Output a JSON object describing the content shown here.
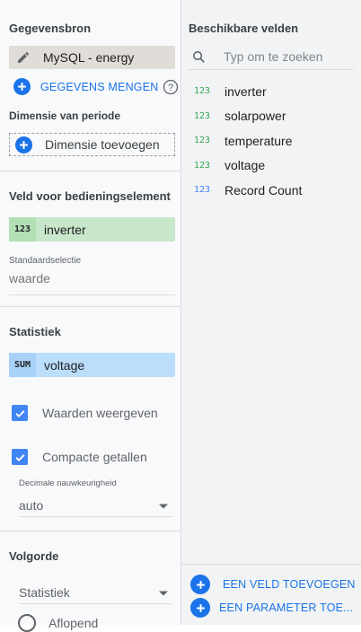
{
  "data_source": {
    "title": "Gegevensbron",
    "source_name": "MySQL - energy",
    "blend_label": "GEGEVENS MENGEN"
  },
  "period": {
    "title": "Dimensie van periode",
    "add_label": "Dimensie toevoegen"
  },
  "control_field": {
    "title": "Veld voor bedieningselement",
    "type_badge": "123",
    "field_name": "inverter",
    "default_label": "Standaardselectie",
    "default_placeholder": "waarde"
  },
  "statistic": {
    "title": "Statistiek",
    "agg_badge": "SUM",
    "field_name": "voltage",
    "show_values_label": "Waarden weergeven",
    "compact_numbers_label": "Compacte getallen",
    "decimal_label": "Decimale nauwkeurigheid",
    "decimal_value": "auto"
  },
  "order": {
    "title": "Volgorde",
    "select_value": "Statistiek",
    "radio_label": "Aflopend"
  },
  "available_fields": {
    "title": "Beschikbare velden",
    "search_placeholder": "Typ om te zoeken",
    "fields": [
      {
        "badge": "123",
        "name": "inverter",
        "color": "#34a853"
      },
      {
        "badge": "123",
        "name": "solarpower",
        "color": "#34a853"
      },
      {
        "badge": "123",
        "name": "temperature",
        "color": "#34a853"
      },
      {
        "badge": "123",
        "name": "voltage",
        "color": "#34a853"
      },
      {
        "badge": "123",
        "name": "Record Count",
        "color": "#4285f4"
      }
    ],
    "add_field_label": "EEN VELD TOEVOEGEN",
    "add_parameter_label": "EEN PARAMETER TOE..."
  },
  "colors": {
    "accent": "#1a73e8",
    "dimension_green": "#c8e6c9",
    "metric_blue": "#bbdefb",
    "source_chip": "#e0dcd8"
  },
  "icons": [
    "pencil-icon",
    "plus-icon",
    "help-icon",
    "search-icon",
    "check-icon",
    "dropdown-arrow-icon",
    "radio-icon"
  ]
}
